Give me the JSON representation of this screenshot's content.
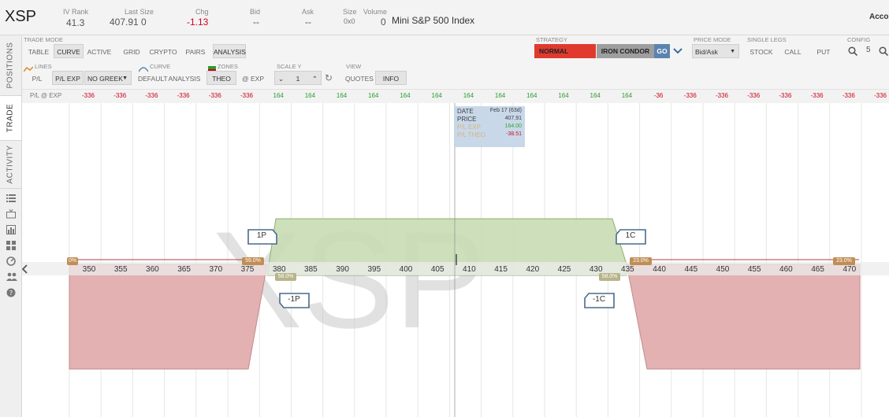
{
  "header": {
    "symbol": "XSP",
    "iv_rank_label": "IV Rank",
    "iv_rank": "41.3",
    "last_size_label": "Last Size",
    "last_size": "407.91 0",
    "chg_label": "Chg",
    "chg": "-1.13",
    "bid_label": "Bid",
    "bid": "--",
    "ask_label": "Ask",
    "ask": "--",
    "size_label": "Size",
    "size": "0x0",
    "volume_label": "Volume",
    "volume": "0",
    "description": "Mini S&P 500 Index",
    "account": "Accou"
  },
  "sidebar": {
    "tabs": [
      "POSITIONS",
      "TRADE",
      "ACTIVITY"
    ],
    "active_tab": "TRADE",
    "icons": [
      "list-icon",
      "tv-icon",
      "chart-icon",
      "grid-icon",
      "gauge-icon",
      "people-icon",
      "help-icon"
    ]
  },
  "toolbar": {
    "trade_mode_label": "TRADE MODE",
    "trade_modes": [
      "TABLE",
      "CURVE",
      "ACTIVE",
      "GRID",
      "CRYPTO",
      "PAIRS",
      "ANALYSIS"
    ],
    "trade_mode_selected": [
      "CURVE",
      "ANALYSIS"
    ],
    "lines_label": "LINES",
    "pl_theo": "P/L THEO",
    "pl_exp": "P/L EXP",
    "greek_select": "NO GREEK",
    "curve_label": "CURVE",
    "curve_default": "DEFAULT",
    "curve_analysis": "ANALYSIS",
    "zones_label": "ZONES",
    "zones_theo": "THEO",
    "zones_exp": "@ EXP",
    "scale_y_label": "SCALE Y",
    "scale_y_value": "1",
    "view_label": "VIEW",
    "view_quotes": "QUOTES",
    "view_info": "INFO",
    "strategy_label": "STRATEGY",
    "strategy_normal": "NORMAL",
    "strategy_selected": "IRON CONDOR",
    "go": "GO",
    "price_mode_label": "PRICE MODE",
    "price_mode": "Bid/Ask",
    "single_legs_label": "SINGLE LEGS",
    "single_legs": [
      "STOCK",
      "CALL",
      "PUT"
    ],
    "config_label": "CONFIG",
    "config_value": "5",
    "colors": {
      "normal": "#e03a2f",
      "iron_condor": "#9e9e9e",
      "go": "#5a84b0"
    }
  },
  "pl_row": {
    "label": "P/L @ EXP",
    "values": [
      "-336",
      "-336",
      "-336",
      "-336",
      "-336",
      "-336",
      "164",
      "164",
      "164",
      "164",
      "164",
      "164",
      "164",
      "164",
      "164",
      "164",
      "164",
      "164",
      "-36",
      "-336",
      "-336",
      "-336",
      "-336",
      "-336",
      "-336",
      "-336"
    ]
  },
  "chart": {
    "watermark": "XSP",
    "strikes": [
      "350",
      "355",
      "360",
      "365",
      "370",
      "375",
      "380",
      "385",
      "390",
      "395",
      "400",
      "405",
      "410",
      "415",
      "420",
      "425",
      "430",
      "435",
      "440",
      "445",
      "450",
      "455",
      "460",
      "465",
      "470"
    ],
    "tooltip": {
      "date_label": "DATE",
      "date": "Feb 17 (63d)",
      "price_label": "PRICE",
      "price": "407.91",
      "pl_exp_label": "P/L EXP",
      "pl_exp": "164.00",
      "pl_theo_label": "P/L THEO",
      "pl_theo": "-38.51"
    },
    "legs": {
      "long_put": "1P",
      "short_put": "-1P",
      "short_call": "-1C",
      "long_call": "1C"
    },
    "probabilities": {
      "far_left": "0%",
      "left_upper": "59.0%",
      "left_lower": "58.0%",
      "right_lower": "58.0%",
      "right_upper": "23.0%",
      "far_right": "23.0%"
    },
    "profit_color": "#c8dcb4",
    "loss_color": "#e3b1b1"
  }
}
